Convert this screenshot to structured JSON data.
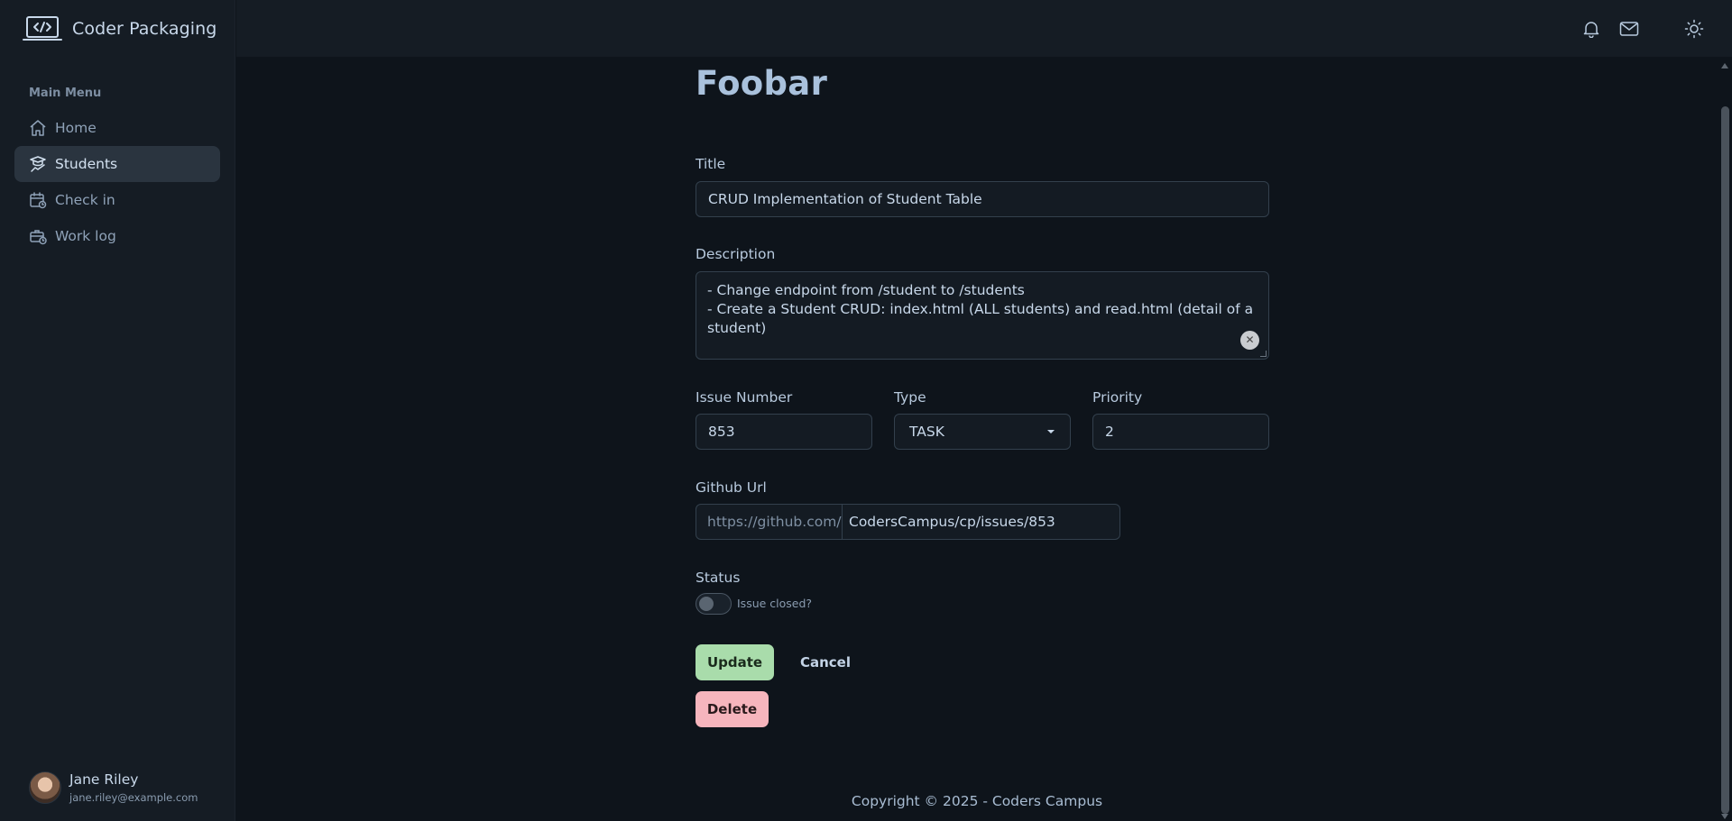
{
  "brand": {
    "title": "Coder Packaging",
    "logo_icon": "code-laptop-icon"
  },
  "sidebar": {
    "heading": "Main Menu",
    "items": [
      {
        "label": "Home",
        "icon": "home-icon",
        "active": false
      },
      {
        "label": "Students",
        "icon": "students-icon",
        "active": true
      },
      {
        "label": "Check in",
        "icon": "calendar-clock-icon",
        "active": false
      },
      {
        "label": "Work log",
        "icon": "briefcase-clock-icon",
        "active": false
      }
    ]
  },
  "user": {
    "name": "Jane Riley",
    "email": "jane.riley@example.com"
  },
  "topbar": {
    "icons": [
      "bell-icon",
      "mail-icon",
      "sun-icon"
    ]
  },
  "page": {
    "title": "Foobar"
  },
  "form": {
    "title_label": "Title",
    "title_value": "CRUD Implementation of Student Table",
    "description_label": "Description",
    "description_lines": [
      "- Change endpoint from /student to /students",
      "- Create a Student CRUD: index.html (ALL students) and read.html (detail of a student)"
    ],
    "issue_label": "Issue Number",
    "issue_value": "853",
    "type_label": "Type",
    "type_value": "TASK",
    "priority_label": "Priority",
    "priority_value": "2",
    "github_label": "Github Url",
    "github_prefix": "https://github.com/",
    "github_value": "CodersCampus/cp/issues/853",
    "status_label": "Status",
    "status_toggle_label": "Issue closed?",
    "status_closed": false
  },
  "buttons": {
    "update": "Update",
    "cancel": "Cancel",
    "delete": "Delete"
  },
  "footer": {
    "text": "Copyright © 2025 - Coders Campus"
  },
  "colors": {
    "update_bg": "#a9dcab",
    "delete_bg": "#f6b5bd",
    "active_nav": "#2a343f"
  }
}
